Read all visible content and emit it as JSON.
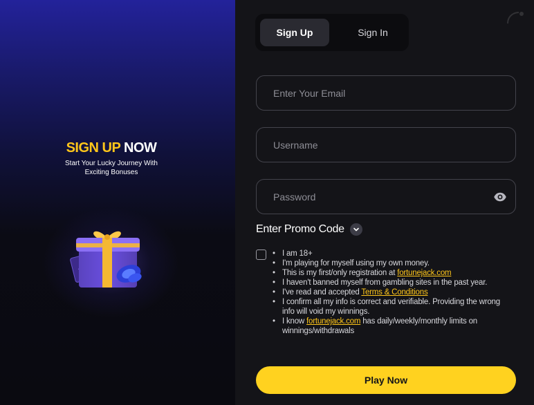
{
  "promo": {
    "title_part1": "SIGN UP",
    "title_part2": "NOW",
    "subtitle_line1": "Start Your Lucky Journey With",
    "subtitle_line2": "Exciting Bonuses",
    "gift_icon": "gift-box-icon"
  },
  "tabs": [
    {
      "label": "Sign Up",
      "active": true
    },
    {
      "label": "Sign In",
      "active": false
    }
  ],
  "form": {
    "email": {
      "placeholder": "Enter Your Email",
      "value": ""
    },
    "username": {
      "placeholder": "Username",
      "value": ""
    },
    "password": {
      "placeholder": "Password",
      "value": "",
      "toggle_icon": "eye-icon"
    },
    "promo_code_label": "Enter Promo Code",
    "promo_toggle_icon": "chevron-down-icon"
  },
  "terms": {
    "checked": false,
    "items": {
      "age": "I am 18+",
      "own_money": "I'm playing for myself using my own money.",
      "first_reg_text": "This is my first/only registration at ",
      "first_reg_link": "fortunejack.com",
      "not_banned": "I haven't banned myself from gambling sites in the past year.",
      "accepted_text": "I've read and accepted ",
      "accepted_link": "Terms & Conditions",
      "info_correct": "I confirm all my info is correct and verifiable. Providing the wrong info will void my winnings.",
      "limits_text_before": "I know ",
      "limits_link": "fortunejack.com",
      "limits_text_after": " has daily/weekly/monthly limits on winnings/withdrawals"
    }
  },
  "cta": {
    "label": "Play Now"
  },
  "colors": {
    "accent_yellow": "#ffd21f",
    "title_yellow": "#ffc61a",
    "panel_blue": "#23229a",
    "background": "#141418"
  }
}
